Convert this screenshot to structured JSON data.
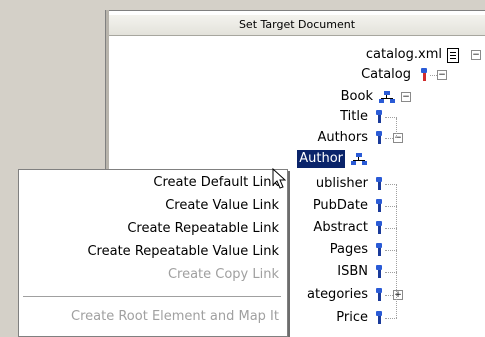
{
  "header": {
    "title": "Set Target Document"
  },
  "tree": {
    "root_file": "catalog.xml",
    "nodes": [
      "Catalog",
      "Book",
      "Title",
      "Authors",
      "Author",
      "Publisher",
      "PubDate",
      "Abstract",
      "Pages",
      "ISBN",
      "Categories",
      "Price"
    ],
    "visible_labels": {
      "publisher": "ublisher",
      "categories": "ategories"
    },
    "expander_minus": "−",
    "expander_plus": "+"
  },
  "context_menu": {
    "items": [
      {
        "label": "Create Default Link",
        "enabled": true
      },
      {
        "label": "Create Value Link",
        "enabled": true
      },
      {
        "label": "Create Repeatable Link",
        "enabled": true
      },
      {
        "label": "Create Repeatable Value Link",
        "enabled": true
      },
      {
        "label": "Create Copy Link",
        "enabled": false
      },
      {
        "label": "Create Root Element and Map It",
        "enabled": false
      }
    ]
  },
  "colors": {
    "selection": "#0a246a",
    "chrome": "#d4d0c8",
    "icon_blue": "#2a5bd6",
    "icon_red": "#d12b2b"
  }
}
